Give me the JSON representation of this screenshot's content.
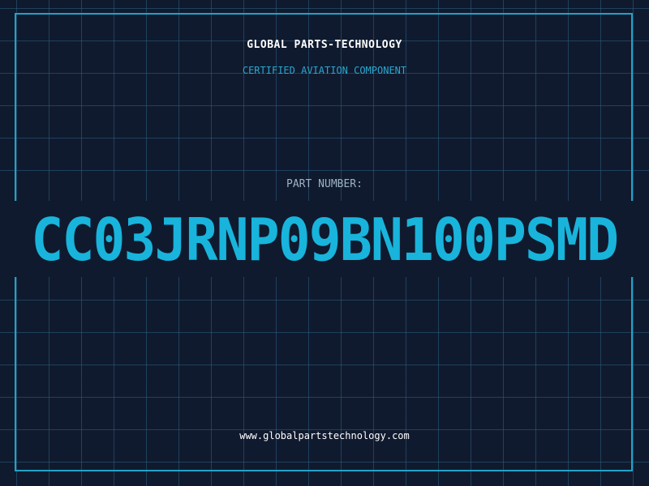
{
  "header": {
    "company": "GLOBAL PARTS-TECHNOLOGY",
    "certification": "CERTIFIED AVIATION COMPONENT"
  },
  "part": {
    "label": "PART NUMBER:",
    "number": "CC03JRNP09BN100PSMD"
  },
  "footer": {
    "website": "www.globalpartstechnology.com"
  },
  "colors": {
    "background": "#101a2e",
    "grid": "#2c6080",
    "frame": "#1fa3c9",
    "accent": "#18b4dc",
    "label": "#9db2c6",
    "text": "#ffffff"
  }
}
